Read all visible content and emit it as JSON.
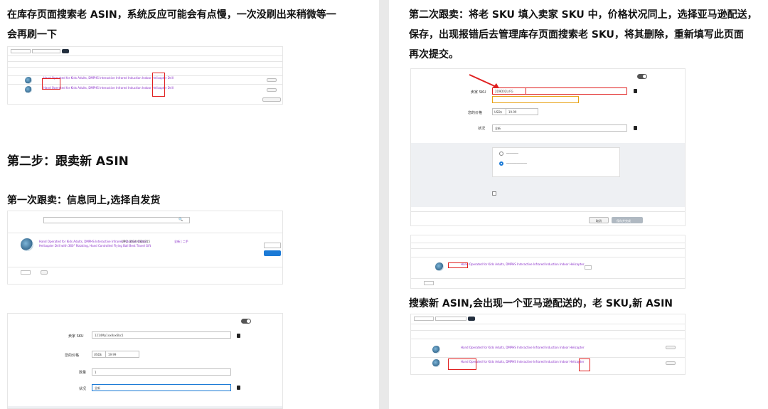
{
  "left_page": {
    "intro_line1": "在库存页面搜索老 ASIN，系统反应可能会有点慢，一次没刷出来稍微等一",
    "intro_line2": "会再刷一下",
    "step2_heading": "第二步：跟卖新 ASIN",
    "first_follow_heading": "第一次跟卖：信息同上,选择自发货",
    "form": {
      "sku_label": "卖家 SKU",
      "sku_value": "1214Mp1xx8xx6bc1",
      "price_label": "您的价格",
      "currency": "USD$",
      "price_value": "19.99",
      "quantity_label": "数量",
      "quantity_value": "1",
      "condition_label": "状况",
      "condition_value": "全新"
    }
  },
  "right_page": {
    "second_follow_line1": "第二次跟卖：将老 SKU 填入卖家 SKU 中，价格状况同上，选择亚马逊配送，",
    "second_follow_line2": "保存，出现报错后去管理库存页面搜索老 SKU，将其删除，重新填写此页面",
    "second_follow_line3": "再次提交。",
    "search_result_heading": "搜索新 ASIN,会出现一个亚马逊配送的，老 SKU,新 ASIN",
    "form": {
      "sku_label": "卖家 SKU",
      "sku_value": "2D9D02LrFG",
      "price_label": "您的价格",
      "currency": "USD$",
      "price_value": "19.99",
      "condition_label": "状况",
      "condition_value": "全新",
      "cancel_label": "取消",
      "save_label": "保存并完成"
    }
  },
  "colors": {
    "highlight": "#e02020",
    "link": "#8a2fc9",
    "button_blue": "#1b7ad6"
  }
}
